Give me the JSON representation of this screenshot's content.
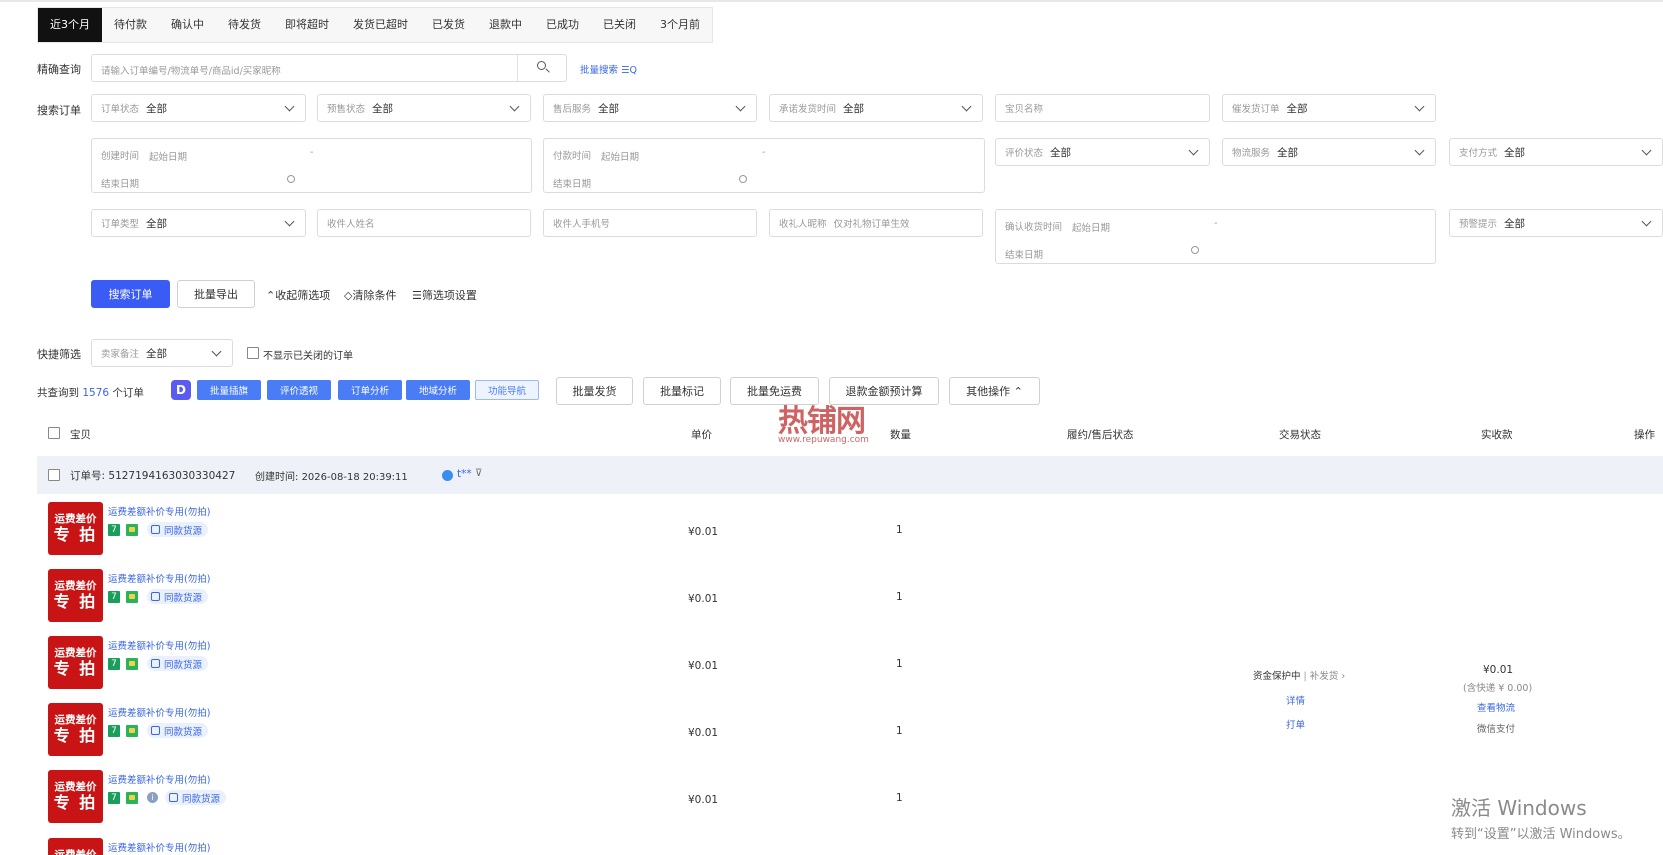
{
  "tabs": [
    "近3个月",
    "待付款",
    "确认中",
    "待发货",
    "即将超时",
    "发货已超时",
    "已发货",
    "退款中",
    "已成功",
    "已关闭",
    "3个月前"
  ],
  "precise": {
    "label": "精确查询",
    "placeholder": "请输入订单编号/物流单号/商品id/买家昵称",
    "batch_link": "批量搜索 ☰Q"
  },
  "search_label": "搜索订单",
  "row1": [
    {
      "key": "订单状态",
      "val": "全部"
    },
    {
      "key": "预售状态",
      "val": "全部"
    },
    {
      "key": "售后服务",
      "val": "全部"
    },
    {
      "key": "承诺发货时间",
      "val": "全部"
    },
    {
      "key": "宝贝名称",
      "val": ""
    },
    {
      "key": "催发货订单",
      "val": "全部"
    }
  ],
  "range_create": {
    "key": "创建时间",
    "start": "起始日期",
    "end": "结束日期"
  },
  "range_pay": {
    "key": "付款时间",
    "start": "起始日期",
    "end": "结束日期"
  },
  "row2": [
    {
      "key": "评价状态",
      "val": "全部"
    },
    {
      "key": "物流服务",
      "val": "全部"
    },
    {
      "key": "支付方式",
      "val": "全部"
    }
  ],
  "row3": [
    {
      "key": "订单类型",
      "val": "全部"
    },
    {
      "key": "收件人姓名",
      "val": ""
    },
    {
      "key": "收件人手机号",
      "val": ""
    },
    {
      "key": "收礼人昵称",
      "val": "仅对礼物订单生效"
    }
  ],
  "range_confirm": {
    "key": "确认收货时间",
    "start": "起始日期",
    "end": "结束日期"
  },
  "warn": {
    "key": "预警提示",
    "val": "全部"
  },
  "actions": {
    "search": "搜索订单",
    "export": "批量导出",
    "collapse": "收起筛选项",
    "clear": "清除条件",
    "settings": "筛选项设置"
  },
  "quick": {
    "label": "快捷筛选",
    "key": "卖家备注",
    "val": "全部",
    "hide_closed": "不显示已关闭的订单"
  },
  "total": {
    "prefix": "共查询到",
    "count": "1576",
    "suffix": "个订单"
  },
  "tools": [
    "批量插旗",
    "评价透视",
    "订单分析",
    "地域分析",
    "功能导航"
  ],
  "bulk": [
    "批量发货",
    "批量标记",
    "批量免运费",
    "退款金额预计算",
    "其他操作 ⌃"
  ],
  "columns": [
    "宝贝",
    "单价",
    "数量",
    "履约/售后状态",
    "交易状态",
    "实收款",
    "操作"
  ],
  "order": {
    "no_label": "订单号:",
    "no": "5127194163030330427",
    "time_label": "创建时间:",
    "time": "2026-08-18 20:39:11",
    "buyer": "t**"
  },
  "product": {
    "name": "运费差额补价专用(勿拍)",
    "img_line1": "运费差价",
    "img_line2": "专 拍",
    "tag7": "7",
    "pill": "同款货源",
    "price": "¥0.01",
    "qty": "1"
  },
  "status": {
    "protect": "资金保护中",
    "reissue": "补发货",
    "detail": "详情",
    "print": "打单"
  },
  "paid": {
    "amount": "¥0.01",
    "shipping": "(含快递 ¥ 0.00)",
    "logistics": "查看物流",
    "method": "微信支付"
  },
  "watermark": {
    "big": "热铺网",
    "small": "www.repuwang.com"
  },
  "windows": {
    "title": "激活 Windows",
    "sub": "转到“设置”以激活 Windows。"
  },
  "colors": {
    "primary": "#3a5cf5",
    "link": "#3a66e6",
    "product_red": "#c81414"
  }
}
